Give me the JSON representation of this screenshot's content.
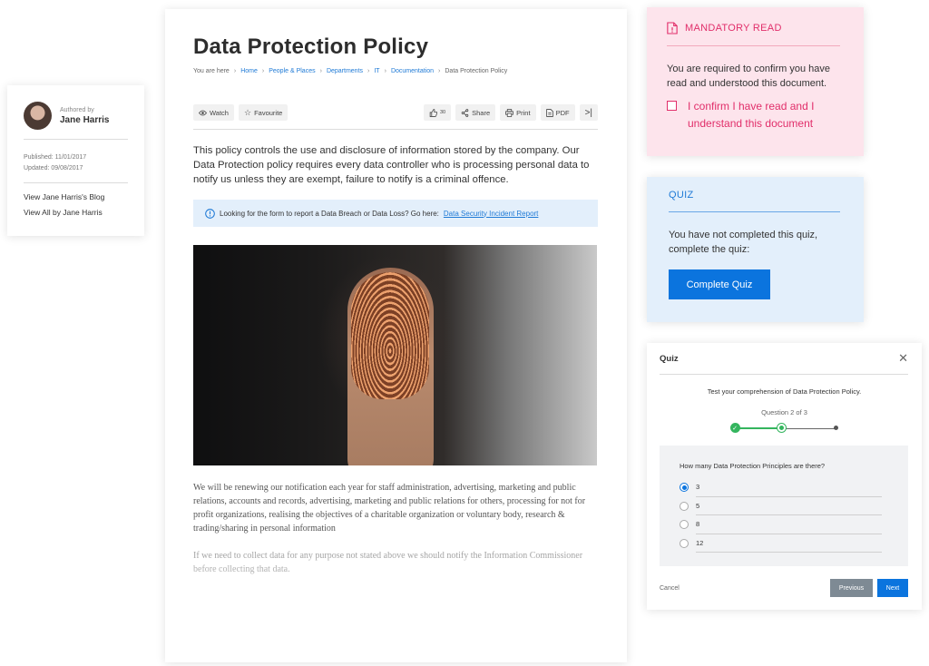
{
  "author": {
    "label": "Authored by",
    "name": "Jane Harris",
    "published": "Published: 11/01/2017",
    "updated": "Updated: 09/08/2017",
    "links": [
      "View Jane Harris's Blog",
      "View All by Jane Harris"
    ]
  },
  "document": {
    "title": "Data Protection Policy",
    "breadcrumb": {
      "prefix": "You are here",
      "items": [
        "Home",
        "People & Places",
        "Departments",
        "IT",
        "Documentation"
      ],
      "current": "Data Protection Policy"
    },
    "toolbar": {
      "watch": "Watch",
      "favourite": "Favourite",
      "likes": "30",
      "share": "Share",
      "print": "Print",
      "pdf": "PDF"
    },
    "intro": "This policy controls the use and disclosure of information stored by the company. Our Data Protection policy requires every data controller who is processing personal data to notify us unless they are exempt, failure to notify is a criminal offence.",
    "notice": {
      "text": "Looking for the form to report a Data Breach or Data Loss? Go here:",
      "link": "Data Security Incident Report"
    },
    "paragraphs": [
      "We will be renewing our notification each year for staff administration, advertising, marketing and public relations, accounts and records, advertising, marketing and public relations for others, processing for not for profit organizations, realising the objectives of a charitable organization or voluntary body, research & trading/sharing in personal information",
      "If we need to collect data for any purpose not stated above we should notify the Information Commissioner before collecting that data."
    ]
  },
  "mandatory": {
    "title": "MANDATORY READ",
    "text": "You are required to confirm you have read and understood this document.",
    "confirm_label": "I confirm I have read and I understand this document"
  },
  "quiz_summary": {
    "title": "QUIZ",
    "text": "You have not completed this quiz, complete the quiz:",
    "button": "Complete Quiz"
  },
  "quiz_dialog": {
    "title": "Quiz",
    "intro": "Test your comprehension of Data Protection Policy.",
    "progress": "Question 2 of 3",
    "question": "How many Data Protection Principles are there?",
    "options": [
      "3",
      "5",
      "8",
      "12"
    ],
    "selected_option": "3",
    "cancel": "Cancel",
    "previous": "Previous",
    "next": "Next"
  },
  "colors": {
    "accent_blue": "#0b74de",
    "mandatory_pink": "#e12e6a",
    "step_green": "#34b55e"
  }
}
